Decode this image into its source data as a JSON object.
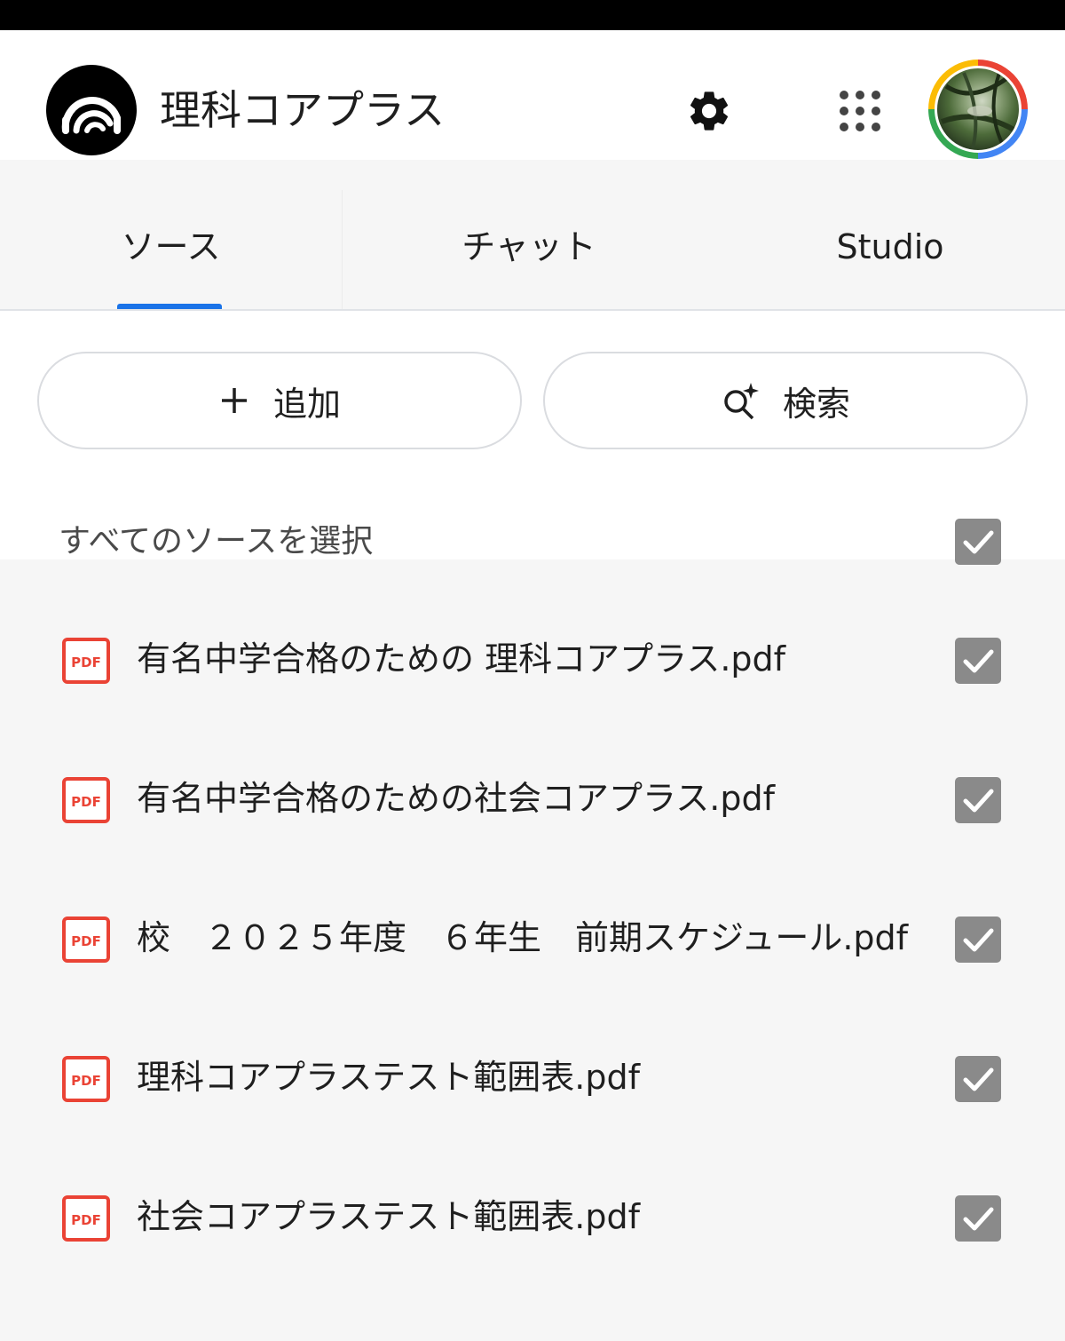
{
  "header": {
    "notebook_title": "理科コアプラス",
    "icons": {
      "logo": "notebooklm-logo-icon",
      "settings": "gear-icon",
      "apps": "apps-grid-icon",
      "avatar": "user-avatar"
    }
  },
  "tabs": [
    {
      "label": "ソース",
      "selected": true
    },
    {
      "label": "チャット",
      "selected": false
    },
    {
      "label": "Studio",
      "selected": false
    }
  ],
  "actions": {
    "add_label": "追加",
    "search_label": "検索"
  },
  "select_all": {
    "label": "すべてのソースを選択",
    "checked": true
  },
  "sources": [
    {
      "name": "有名中学合格のための 理科コアプラス.pdf",
      "type": "pdf",
      "checked": true
    },
    {
      "name": "有名中学合格のための社会コアプラス.pdf",
      "type": "pdf",
      "checked": true
    },
    {
      "name": "校　２０２５年度　６年生　前期スケジュール.pdf",
      "type": "pdf",
      "checked": true
    },
    {
      "name": "理科コアプラステスト範囲表.pdf",
      "type": "pdf",
      "checked": true
    },
    {
      "name": "社会コアプラステスト範囲表.pdf",
      "type": "pdf",
      "checked": true
    }
  ],
  "colors": {
    "accent": "#1a73e8",
    "pdf_red": "#ea4335",
    "checkbox_gray": "#8a8a8a",
    "background": "#f6f6f6"
  }
}
